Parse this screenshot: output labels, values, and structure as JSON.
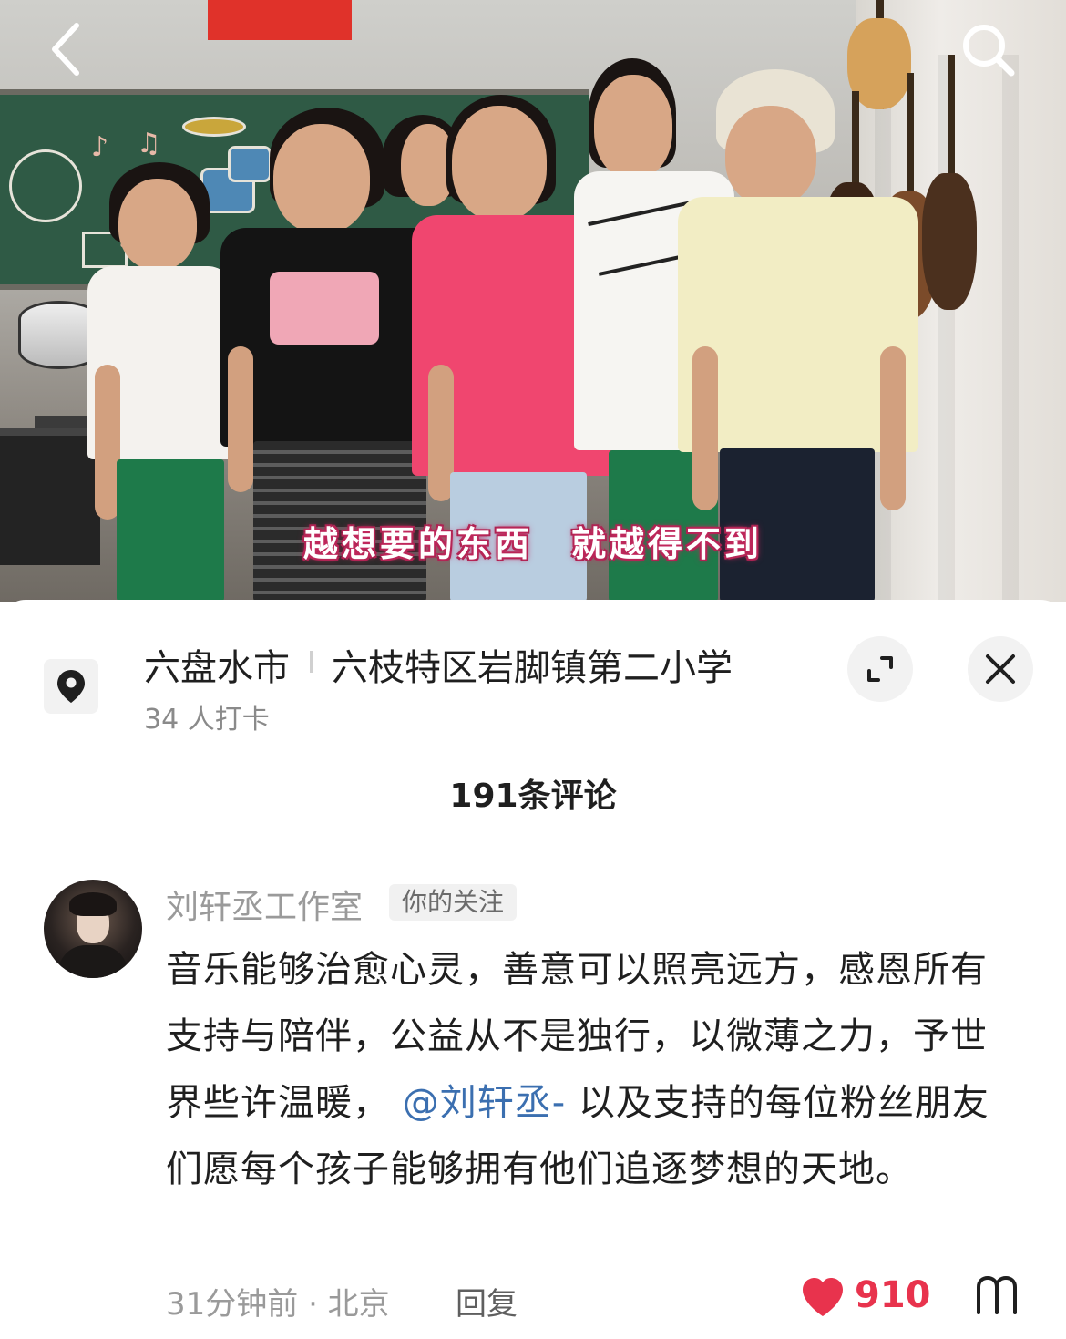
{
  "video": {
    "subtitle": "越想要的东西　就越得不到"
  },
  "location": {
    "city": "六盘水市",
    "place": "六枝特区岩脚镇第二小学",
    "checkins": "34 人打卡"
  },
  "comments": {
    "count_label": "191条评论",
    "items": [
      {
        "username": "刘轩丞工作室",
        "badge": "你的关注",
        "text_before": "音乐能够治愈心灵，善意可以照亮远方，感恩所有支持与陪伴，公益从不是独行，以微薄之力，予世界些许温暖，",
        "mention": "@刘轩丞-",
        "text_after": "以及支持的每位粉丝朋友们愿每个孩子能够拥有他们追逐梦想的天地。",
        "meta": "31分钟前 · 北京",
        "reply_label": "回复",
        "likes": "910"
      }
    ]
  },
  "colors": {
    "like": "#e8334d",
    "mention": "#3b6fb0",
    "banner": "#e0322a",
    "subtitle_glow": "#c42a5f"
  }
}
